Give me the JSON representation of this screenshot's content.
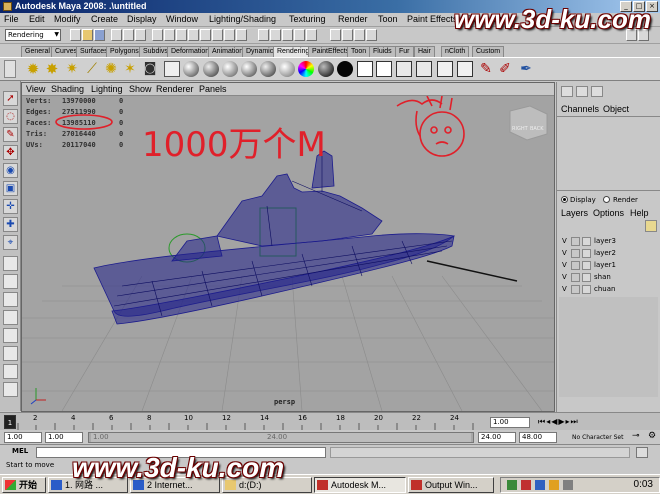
{
  "window": {
    "title": "Autodesk Maya 2008: .\\untitled"
  },
  "menu": [
    "File",
    "Edit",
    "Modify",
    "Create",
    "Display",
    "Window",
    "Lighting/Shading",
    "Texturing",
    "Render",
    "Toon",
    "Paint Effects",
    "Fur",
    "Help"
  ],
  "status_line": {
    "mode": "Rendering"
  },
  "shelf_tabs": [
    "General",
    "Curves",
    "Surfaces",
    "Polygons",
    "Subdivs",
    "Deformation",
    "Animation",
    "Dynamics",
    "Rendering",
    "PaintEffects",
    "Toon",
    "Fluids",
    "Fur",
    "Hair",
    "nCloth",
    "Custom"
  ],
  "active_shelf_tab": "Rendering",
  "shelf_icons": [
    "spotlight-icon",
    "pointlight-icon",
    "directional-light-icon",
    "area-light-icon",
    "ambient-light-icon",
    "camera-icon",
    "create-render-node-icon",
    "material-sphere-icon",
    "material-sphere-icon",
    "material-sphere-icon",
    "material-sphere-icon",
    "material-sphere-icon",
    "material-sphere-icon",
    "material-sphere-icon",
    "color-ball-icon",
    "dark-sphere-icon",
    "black-sphere-icon",
    "render-view-icon",
    "render-settings-icon",
    "render-icon",
    "batch-render-icon",
    "ipr-icon",
    "hypershade-icon",
    "paint-icon",
    "paint-icon"
  ],
  "viewport": {
    "menu": [
      "View",
      "Shading",
      "Lighting",
      "Show",
      "Renderer",
      "Panels"
    ],
    "hud": [
      {
        "label": "Verts:",
        "value": "13970000",
        "count": "0"
      },
      {
        "label": "Edges:",
        "value": "27511990",
        "count": "0"
      },
      {
        "label": "Faces:",
        "value": "13985110",
        "count": "0"
      },
      {
        "label": "Tris:",
        "value": "27016440",
        "count": "0"
      },
      {
        "label": "UVs:",
        "value": "20117040",
        "count": "0"
      }
    ],
    "camera": "persp",
    "viewcube": {
      "left": "RIGHT",
      "right": "BACK"
    },
    "annotation": "1000万个M",
    "colors": {
      "background": "#a3a3a3",
      "wire": "#1c1c8c",
      "grid": "#8d8d8d",
      "scribble": "#e0202a"
    }
  },
  "channel_box": {
    "tabs": [
      "Channels",
      "Object"
    ]
  },
  "layer_editor": {
    "radios": [
      {
        "label": "Display",
        "selected": true
      },
      {
        "label": "Render",
        "selected": false
      }
    ],
    "menu": [
      "Layers",
      "Options",
      "Help"
    ],
    "layers": [
      {
        "v": "V",
        "name": "layer3"
      },
      {
        "v": "V",
        "name": "layer2"
      },
      {
        "v": "V",
        "name": "layer1"
      },
      {
        "v": "V",
        "name": "shan"
      },
      {
        "v": "V",
        "name": "chuan"
      }
    ]
  },
  "time_slider": {
    "ticks": [
      "2",
      "4",
      "6",
      "8",
      "10",
      "12",
      "14",
      "16",
      "18",
      "20",
      "22",
      "24"
    ],
    "current_frame": "1",
    "current_field": "1.00"
  },
  "range_slider": {
    "start": "1.00",
    "start_inner": "1.00",
    "end_inner": "24.00",
    "end": "48.00",
    "slider_start": "1.00",
    "slider_end": "24.00",
    "character_set": "No Character Set"
  },
  "command_line": {
    "label": "MEL"
  },
  "help_line": {
    "text": "Start to move"
  },
  "taskbar": {
    "items": [
      {
        "label": "开始",
        "pressed": false
      },
      {
        "label": "1. 网路 ...",
        "pressed": false
      },
      {
        "label": "2 Internet...",
        "pressed": false
      },
      {
        "label": "d:(D:)",
        "pressed": false
      },
      {
        "label": "Autodesk M...",
        "pressed": true
      },
      {
        "label": "Output Win...",
        "pressed": false
      }
    ],
    "clock": "0:03"
  },
  "watermarks": [
    "www.3d-ku.com",
    "www.3d-ku.com"
  ]
}
